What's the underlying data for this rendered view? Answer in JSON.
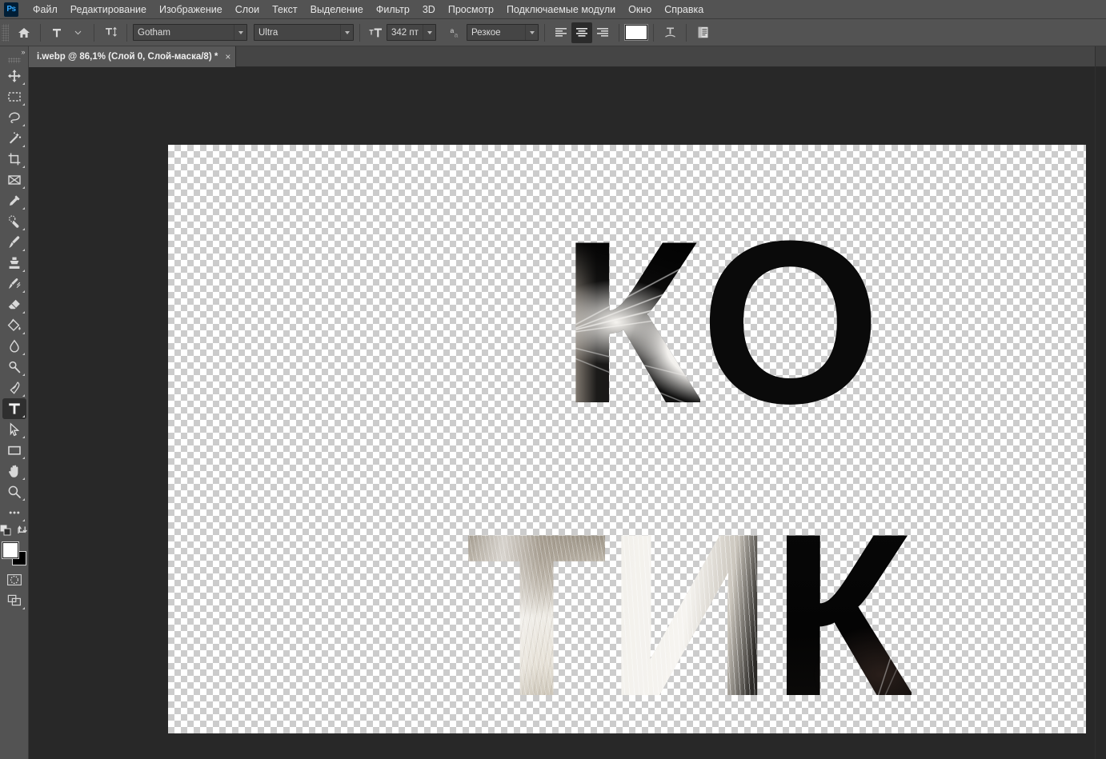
{
  "app": {
    "name": "Ps",
    "logo_bg": "#001e36",
    "logo_fg": "#31a8ff"
  },
  "menubar": {
    "items": [
      {
        "label": "Файл"
      },
      {
        "label": "Редактирование"
      },
      {
        "label": "Изображение"
      },
      {
        "label": "Слои"
      },
      {
        "label": "Текст"
      },
      {
        "label": "Выделение"
      },
      {
        "label": "Фильтр"
      },
      {
        "label": "3D"
      },
      {
        "label": "Просмотр"
      },
      {
        "label": "Подключаемые модули"
      },
      {
        "label": "Окно"
      },
      {
        "label": "Справка"
      }
    ]
  },
  "options_bar": {
    "home_icon": "home-icon",
    "tool_preset_icon": "type-tool-icon",
    "orientation_icon": "text-orientation-icon",
    "font_family": {
      "value": "Gotham",
      "icon": "chevron-down-icon"
    },
    "font_style": {
      "value": "Ultra",
      "icon": "chevron-down-icon"
    },
    "font_size_icon": "font-size-icon",
    "font_size": {
      "value": "342 пт",
      "icon": "chevron-down-icon"
    },
    "antialias_icon": "anti-aliasing-icon",
    "antialias": {
      "value": "Резкое",
      "icon": "chevron-down-icon"
    },
    "align_left": "align-left-icon",
    "align_center": "align-center-icon",
    "align_right": "align-right-icon",
    "align_selected": "center",
    "color_swatch": "#ffffff",
    "warp_icon": "warp-text-icon",
    "panels_icon": "character-paragraph-panel-icon"
  },
  "tab_bar": {
    "document": {
      "title": "i.webp @ 86,1% (Слой 0, Слой-маска/8) *",
      "close_label": "×"
    }
  },
  "toolbar": {
    "expand_label": "»",
    "tools": [
      {
        "name": "move-tool",
        "icon": "move-icon",
        "active": false
      },
      {
        "name": "marquee-tool",
        "icon": "rectangular-marquee-icon",
        "active": false
      },
      {
        "name": "lasso-tool",
        "icon": "lasso-icon",
        "active": false
      },
      {
        "name": "quick-selection-tool",
        "icon": "magic-wand-icon",
        "active": false
      },
      {
        "name": "crop-tool",
        "icon": "crop-icon",
        "active": false
      },
      {
        "name": "frame-tool",
        "icon": "frame-icon",
        "active": false
      },
      {
        "name": "eyedropper-tool",
        "icon": "eyedropper-icon",
        "active": false
      },
      {
        "name": "healing-brush-tool",
        "icon": "spot-healing-icon",
        "active": false
      },
      {
        "name": "brush-tool",
        "icon": "brush-icon",
        "active": false
      },
      {
        "name": "clone-stamp-tool",
        "icon": "clone-stamp-icon",
        "active": false
      },
      {
        "name": "history-brush-tool",
        "icon": "history-brush-icon",
        "active": false
      },
      {
        "name": "eraser-tool",
        "icon": "eraser-icon",
        "active": false
      },
      {
        "name": "gradient-tool",
        "icon": "paint-bucket-icon",
        "active": false
      },
      {
        "name": "blur-tool",
        "icon": "blur-icon",
        "active": false
      },
      {
        "name": "dodge-tool",
        "icon": "dodge-icon",
        "active": false
      },
      {
        "name": "pen-tool",
        "icon": "pen-icon",
        "active": false
      },
      {
        "name": "type-tool",
        "icon": "type-icon",
        "active": true
      },
      {
        "name": "path-selection-tool",
        "icon": "path-selection-arrow-icon",
        "active": false
      },
      {
        "name": "shape-tool",
        "icon": "rectangle-shape-icon",
        "active": false
      },
      {
        "name": "hand-tool",
        "icon": "hand-icon",
        "active": false
      },
      {
        "name": "zoom-tool",
        "icon": "zoom-magnifier-icon",
        "active": false
      },
      {
        "name": "edit-toolbar",
        "icon": "ellipsis-icon",
        "active": false
      }
    ],
    "default_colors_icon": "default-colors-icon",
    "swap_colors_icon": "swap-colors-icon",
    "foreground_color": "#ffffff",
    "background_color": "#000000",
    "quick_mask_icon": "quick-mask-icon",
    "screen_mode_icon": "screen-mode-icon"
  },
  "canvas": {
    "zoom_percent": "86,1%",
    "background": "transparent-checkerboard",
    "artwork": {
      "line1": [
        "К",
        "О"
      ],
      "line2": [
        "Т",
        "И",
        "К"
      ],
      "full_text": "КОТИК",
      "fill": "cat-photo-clipping-mask"
    }
  },
  "colors": {
    "chrome": "#535353",
    "workspace": "#282828",
    "tab_active": "#585858",
    "tab_strip": "#454545",
    "text": "#e8e8e8",
    "accent": "#31a8ff"
  }
}
